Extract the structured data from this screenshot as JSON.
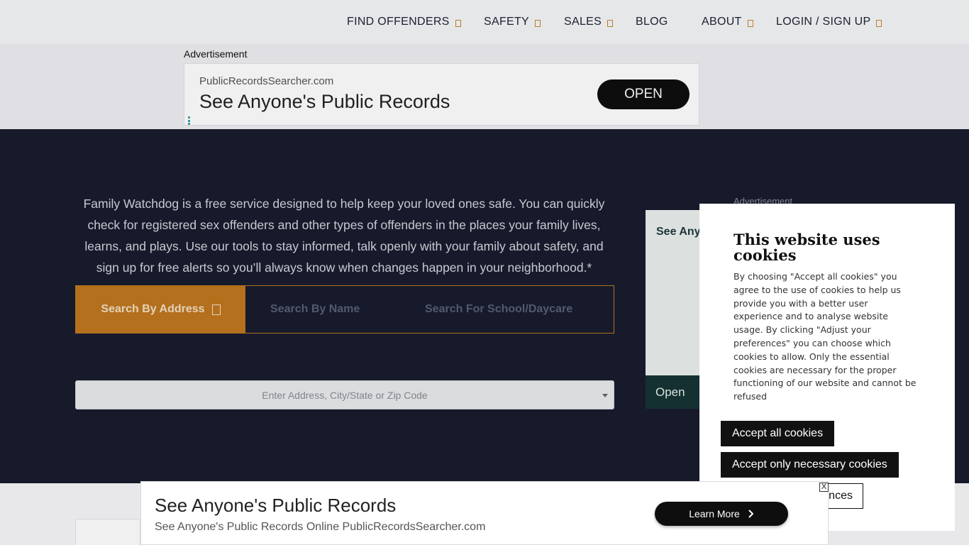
{
  "nav": {
    "items": [
      {
        "label": "FIND OFFENDERS",
        "has_caret": true
      },
      {
        "label": "SAFETY",
        "has_caret": true
      },
      {
        "label": "SALES",
        "has_caret": true
      },
      {
        "label": "BLOG",
        "has_caret": false
      },
      {
        "label": "ABOUT",
        "has_caret": true
      },
      {
        "label": "LOGIN / SIGN UP",
        "has_caret": true
      }
    ]
  },
  "top_ad": {
    "label": "Advertisement",
    "domain": "PublicRecordsSearcher.com",
    "headline": "See Anyone's Public Records",
    "button": "OPEN"
  },
  "hero": {
    "description": "Family Watchdog is a free service designed to help keep your loved ones safe. You can quickly check for registered sex offenders and other types of offenders in the places your family lives, learns, and plays. Use our tools to stay informed, talk openly with your family about safety, and sign up for free alerts so you’ll always know when changes happen in your neighborhood.*"
  },
  "search_tabs": [
    {
      "label": "Search By Address",
      "active": true
    },
    {
      "label": "Search By Name",
      "active": false
    },
    {
      "label": "Search For School/Daycare",
      "active": false
    }
  ],
  "address_input": {
    "placeholder": "Enter Address, City/State or Zip Code"
  },
  "side_ad": {
    "label": "Advertisement",
    "headline": "See Anyone's Public Records",
    "button": "Open"
  },
  "cookie_modal": {
    "title": "This website uses cookies",
    "body": "By choosing \"Accept all cookies\" you agree to the use of cookies to help us provide you with a better user experience and to analyse website usage. By clicking \"Adjust your preferences\" you can choose which cookies to allow. Only the essential cookies are necessary for the proper functioning of our website and cannot be refused",
    "accept_all": "Accept all cookies",
    "accept_necessary": "Accept only necessary cookies",
    "adjust": "Adjust your preferences"
  },
  "bottom_ad": {
    "headline": "See Anyone's Public Records",
    "subtext": "See Anyone's Public Records Online PublicRecordsSearcher.com",
    "button": "Learn More",
    "close": "X"
  },
  "colors": {
    "hero_bg": "#191c2e",
    "accent_orange": "#c0771f",
    "nav_text": "#1e2235"
  }
}
